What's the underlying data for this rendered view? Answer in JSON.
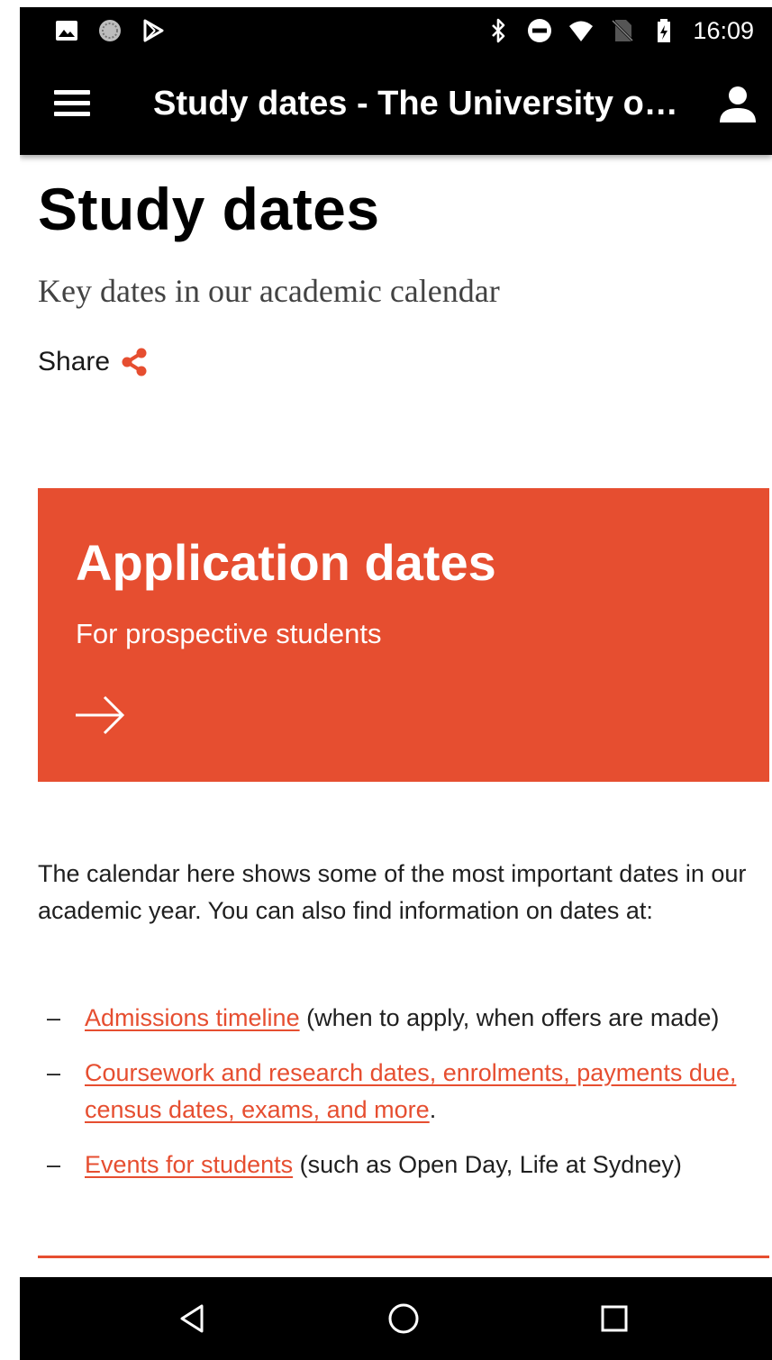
{
  "status_bar": {
    "time": "16:09",
    "left_icons": [
      "image-icon",
      "radio-icon",
      "play-store-icon"
    ],
    "right_icons": [
      "bluetooth-icon",
      "do-not-disturb-icon",
      "wifi-icon",
      "no-sim-icon",
      "battery-icon"
    ]
  },
  "app_bar": {
    "title": "Study dates - The University o…",
    "menu_icon": "hamburger-menu-icon",
    "account_icon": "account-icon"
  },
  "page": {
    "title": "Study dates",
    "subtitle": "Key dates in our academic calendar",
    "share_label": "Share"
  },
  "card": {
    "title": "Application dates",
    "subtitle": "For prospective students",
    "arrow_icon": "arrow-right-icon",
    "color": "#e64e30"
  },
  "intro": "The calendar here shows some of the most important dates in our academic year. You can also find information on dates at:",
  "links": [
    {
      "dash": "–",
      "link": "Admissions timeline",
      "rest": " (when to apply, when offers are made)"
    },
    {
      "dash": "–",
      "link": "Coursework and research dates, enrolments, payments due, census dates, exams, and more",
      "rest": "."
    },
    {
      "dash": "–",
      "link": "Events for students",
      "rest": " (such as Open Day, Life at Sydney)"
    }
  ],
  "nav_bar": {
    "back_icon": "back-triangle-icon",
    "home_icon": "home-circle-icon",
    "recents_icon": "recents-square-icon"
  },
  "colors": {
    "accent": "#e64e30",
    "bar": "#000000",
    "text": "#1f1f1f"
  }
}
